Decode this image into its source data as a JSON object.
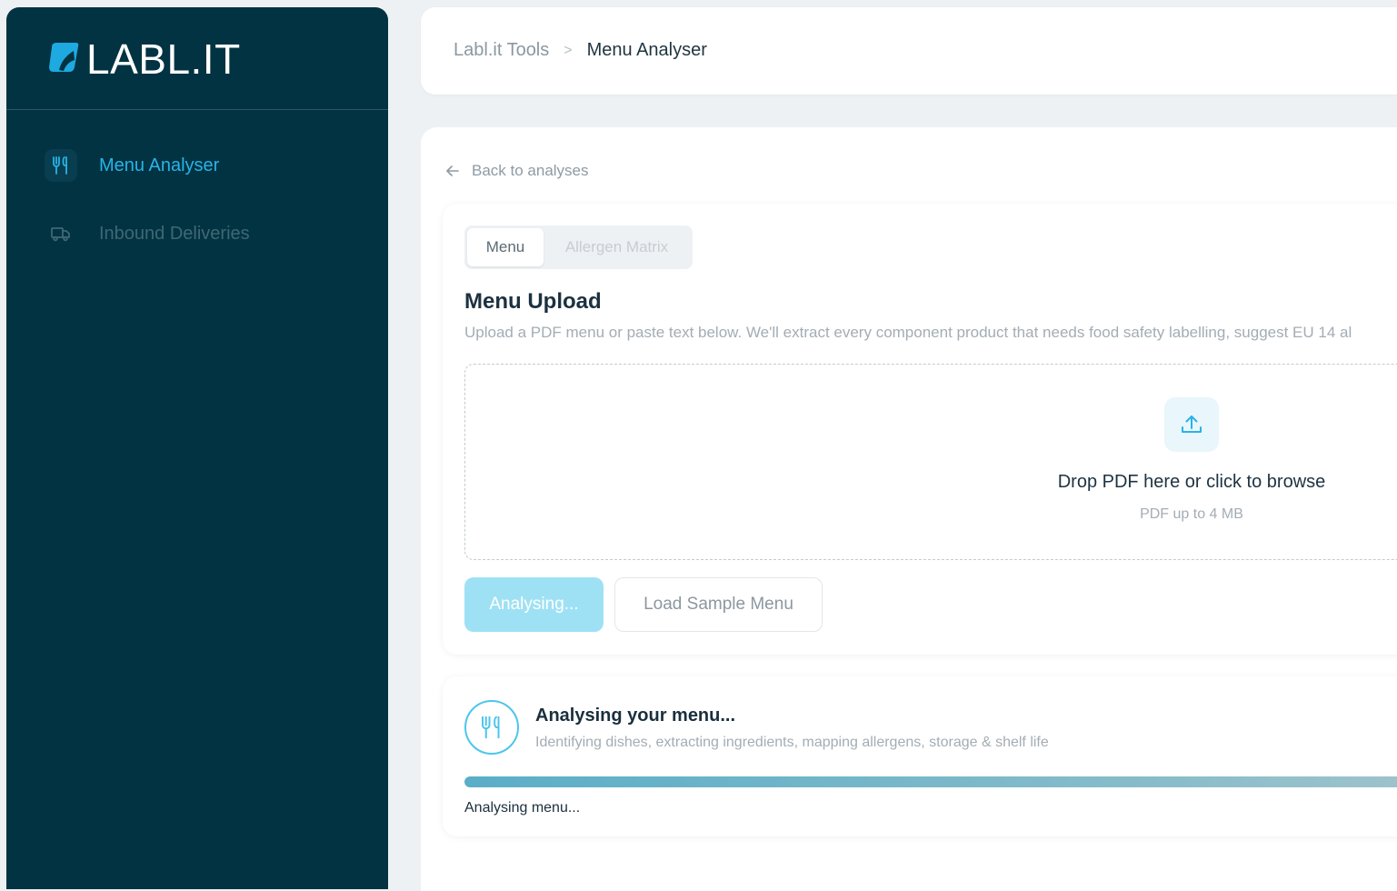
{
  "app": {
    "logo_text": "LABL.IT",
    "colors": {
      "sidebar": "#023342",
      "accent": "#29b3e8",
      "button_disabled": "#9fe1f4"
    }
  },
  "sidebar": {
    "items": [
      {
        "label": "Menu Analyser",
        "icon": "fork-knife-icon",
        "active": true
      },
      {
        "label": "Inbound Deliveries",
        "icon": "truck-icon",
        "active": false
      }
    ]
  },
  "header": {
    "breadcrumb": {
      "parent": "Labl.it Tools",
      "separator": ">",
      "current": "Menu Analyser"
    }
  },
  "main": {
    "back_label": "Back to analyses",
    "tabs": [
      {
        "label": "Menu",
        "active": true
      },
      {
        "label": "Allergen Matrix",
        "active": false
      }
    ],
    "upload": {
      "title": "Menu Upload",
      "description": "Upload a PDF menu or paste text below. We'll extract every component product that needs food safety labelling, suggest EU 14 al",
      "dropzone": {
        "icon": "upload-icon",
        "title": "Drop PDF here or click to browse",
        "subtitle": "PDF up to 4 MB"
      },
      "analyse_button": "Analysing...",
      "sample_button": "Load Sample Menu"
    },
    "progress": {
      "icon": "fork-knife-icon",
      "title": "Analysing your menu...",
      "subtitle": "Identifying dishes, extracting ingredients, mapping allergens, storage & shelf life",
      "percent": 100,
      "status": "Analysing menu..."
    }
  }
}
